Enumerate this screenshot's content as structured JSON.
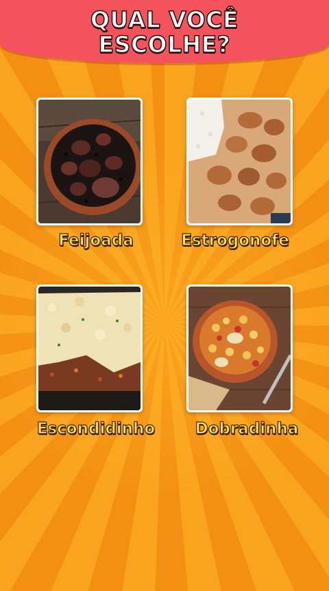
{
  "header": {
    "title_line1": "QUAL VOCÊ",
    "title_line2": "ESCOLHE?"
  },
  "options": [
    {
      "label": "Feijoada",
      "image": "feijoada-dish-image"
    },
    {
      "label": "Estrogonofe",
      "image": "estrogonofe-dish-image"
    },
    {
      "label": "Escondidinho",
      "image": "escondidinho-dish-image"
    },
    {
      "label": "Dobradinha",
      "image": "dobradinha-dish-image"
    }
  ],
  "colors": {
    "banner": "#f4525c",
    "background": "#f7a21c",
    "label_text": "#ffe74a",
    "outline": "#3b1d00"
  }
}
